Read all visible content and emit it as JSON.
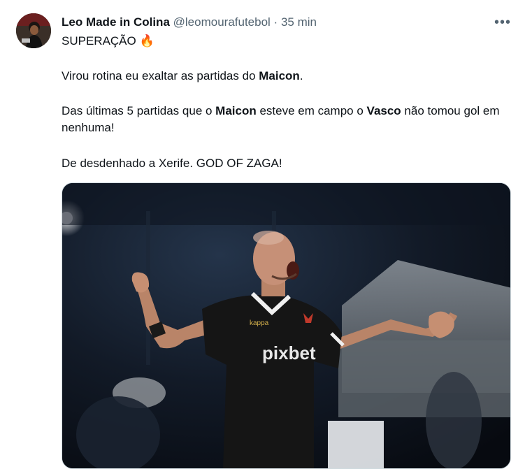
{
  "tweet": {
    "display_name": "Leo Made in Colina",
    "handle": "@leomourafutebol",
    "separator": "·",
    "time": "35 min",
    "more_icon": "more-horizontal-icon",
    "lines": {
      "title": "SUPERAÇÃO",
      "title_emoji": "🔥",
      "line2_prefix": "Virou rotina eu exaltar as partidas do ",
      "line2_bold": "Maicon",
      "line2_suffix": ".",
      "line3_a": "Das últimas 5 partidas que o ",
      "line3_bold1": "Maicon",
      "line3_b": " esteve em campo o ",
      "line3_bold2": "Vasco",
      "line3_c": " não tomou gol em nenhuma!",
      "line4": "De desdenhado a Xerife. GOD OF ZAGA!"
    },
    "media": {
      "jersey_sponsor": "pixbet",
      "jersey_brand": "kappa"
    }
  }
}
